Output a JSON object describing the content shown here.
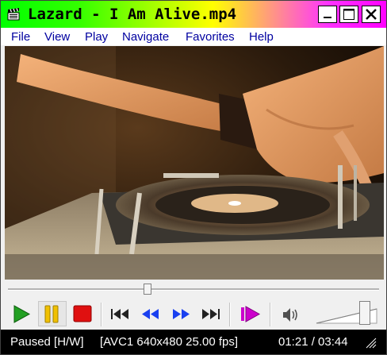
{
  "window": {
    "title": "Lazard - I Am Alive.mp4",
    "app_icon": "clapperboard-icon",
    "controls": [
      "minimize-icon",
      "maximize-icon",
      "close-icon"
    ]
  },
  "menu": {
    "items": [
      "File",
      "View",
      "Play",
      "Navigate",
      "Favorites",
      "Help"
    ]
  },
  "video": {
    "content": "DJ hands on turntable"
  },
  "seek": {
    "position_fraction": 0.376
  },
  "toolbar": {
    "buttons": [
      "play-icon",
      "pause-icon",
      "stop-icon",
      "previous-icon",
      "rewind-icon",
      "fast-forward-icon",
      "next-icon",
      "frame-step-icon",
      "speaker-icon"
    ],
    "pause_pressed": true,
    "volume_fraction": 0.8
  },
  "colors": {
    "play": "#22a022",
    "pause": "#f0c000",
    "stop": "#e01010",
    "nav": "#1a40f0",
    "frame_step": "#cc00cc",
    "menu_text": "#0000a0"
  },
  "status": {
    "state": "Paused [H/W]",
    "codec_info": "[AVC1 640x480 25.00 fps]",
    "time": "01:21 / 03:44"
  }
}
